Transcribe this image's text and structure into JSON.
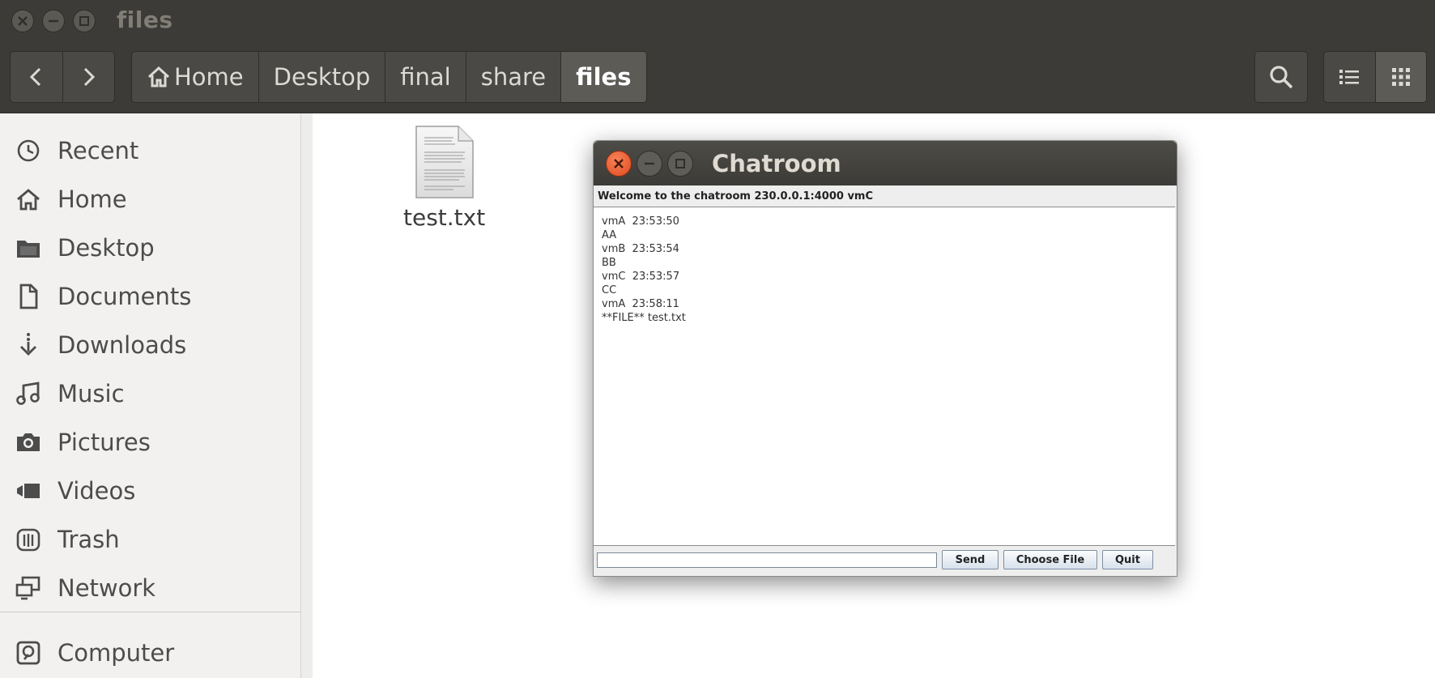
{
  "window": {
    "title": "files"
  },
  "toolbar": {
    "breadcrumbs": [
      "Home",
      "Desktop",
      "final",
      "share",
      "files"
    ]
  },
  "sidebar": {
    "items": [
      {
        "label": "Recent",
        "icon": "clock-icon"
      },
      {
        "label": "Home",
        "icon": "home-icon"
      },
      {
        "label": "Desktop",
        "icon": "folder-icon"
      },
      {
        "label": "Documents",
        "icon": "document-icon"
      },
      {
        "label": "Downloads",
        "icon": "download-icon"
      },
      {
        "label": "Music",
        "icon": "music-icon"
      },
      {
        "label": "Pictures",
        "icon": "camera-icon"
      },
      {
        "label": "Videos",
        "icon": "video-icon"
      },
      {
        "label": "Trash",
        "icon": "trash-icon"
      },
      {
        "label": "Network",
        "icon": "network-icon"
      },
      {
        "label": "Computer",
        "icon": "computer-icon"
      }
    ]
  },
  "files": [
    {
      "name": "test.txt",
      "icon": "text-file-icon"
    }
  ],
  "chat": {
    "title": "Chatroom",
    "welcome": "Welcome to the chatroom 230.0.0.1:4000 vmC",
    "messages": [
      "vmA  23:53:50",
      "AA",
      "vmB  23:53:54",
      "BB",
      "vmC  23:53:57",
      "CC",
      "vmA  23:58:11",
      "**FILE** test.txt"
    ],
    "input_value": "",
    "send_label": "Send",
    "choose_file_label": "Choose File",
    "quit_label": "Quit"
  },
  "colors": {
    "titlebar": "#3c3b37",
    "sidebar_bg": "#f2f1f0",
    "close_button": "#e95420"
  }
}
